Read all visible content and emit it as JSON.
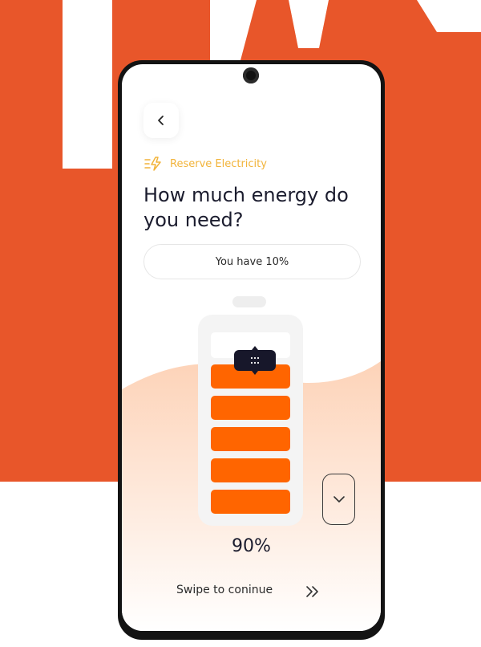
{
  "colors": {
    "brand_orange": "#e8562a",
    "battery_fill": "#ff6500",
    "tag_yellow": "#f2b43b",
    "dark": "#17172a"
  },
  "header": {
    "back_icon": "chevron-left-icon"
  },
  "tag": {
    "icon": "lightning-icon",
    "label": "Reserve Electricity"
  },
  "title": "How much energy do you need?",
  "status_pill": {
    "label": "You have 10%"
  },
  "battery": {
    "level_percent": 90,
    "filled_segments": 5,
    "handle_icon": "drag-grid-icon"
  },
  "level_label": "90%",
  "controls": {
    "down_icon": "chevron-down-icon"
  },
  "footer": {
    "swipe_label": "Swipe to coninue",
    "swipe_icon": "double-chevron-right-icon"
  }
}
